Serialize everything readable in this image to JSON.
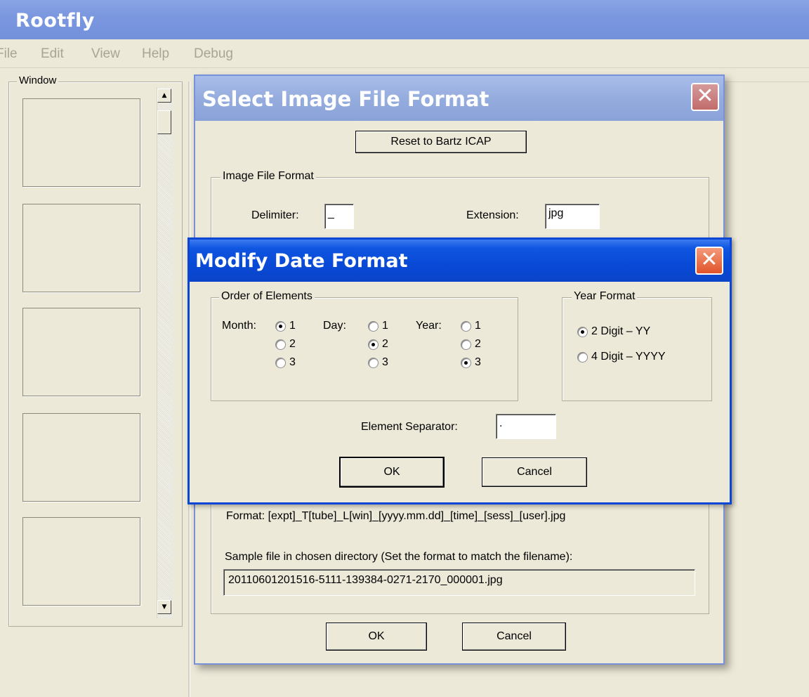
{
  "app": {
    "title": "Rootfly",
    "icon_glyph": "⁝"
  },
  "menu": [
    "File",
    "Edit",
    "View",
    "Help",
    "Debug"
  ],
  "left_panel": {
    "label": "Window"
  },
  "image_format_dialog": {
    "title": "Select Image File Format",
    "close_glyph": "✕",
    "reset_button": "Reset to Bartz ICAP",
    "group_label": "Image File Format",
    "delimiter_label": "Delimiter:",
    "delimiter_value": "_",
    "extension_label": "Extension:",
    "extension_value": "jpg",
    "format_text": "Format:  [expt]_T[tube]_L[win]_[yyyy.mm.dd]_[time]_[sess]_[user].jpg",
    "sample_label": "Sample file in chosen directory (Set the format to match the filename):",
    "sample_value": "20110601201516-5111-139384-0271-2170_000001.jpg",
    "ok": "OK",
    "cancel": "Cancel"
  },
  "date_dialog": {
    "title": "Modify Date Format",
    "close_glyph": "✕",
    "order_group": "Order of Elements",
    "month_label": "Month:",
    "day_label": "Day:",
    "year_label": "Year:",
    "options": [
      "1",
      "2",
      "3"
    ],
    "month_selected": 1,
    "day_selected": 2,
    "year_selected": 3,
    "year_group": "Year Format",
    "year_opt_2": "2 Digit – YY",
    "year_opt_4": "4 Digit – YYYY",
    "year_format_selected": "2 Digit – YY",
    "separator_label": "Element Separator:",
    "separator_value": ".",
    "ok": "OK",
    "cancel": "Cancel"
  }
}
